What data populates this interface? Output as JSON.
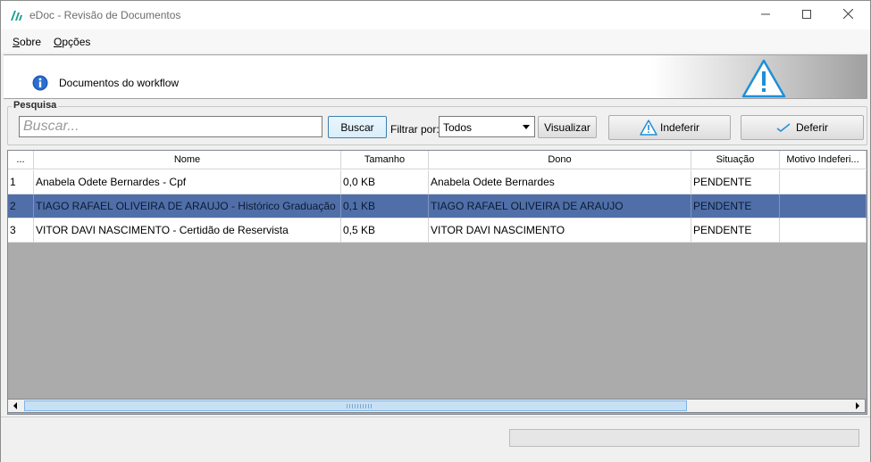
{
  "window": {
    "title": "eDoc - Revisão de Documentos",
    "controls": {
      "minimize": "minimize-icon",
      "maximize": "maximize-icon",
      "close": "close-icon"
    }
  },
  "menu": {
    "items": [
      {
        "label": "Sobre",
        "mnemonic": "S"
      },
      {
        "label": "Opções",
        "mnemonic": "O"
      }
    ]
  },
  "header": {
    "text": "Documentos do workflow",
    "icon": "info-icon",
    "banner_icon": "warning-triangle-icon"
  },
  "search": {
    "group_label": "Pesquisa",
    "placeholder": "Buscar...",
    "search_button": "Buscar",
    "filter_label": "Filtrar por:",
    "filter_value": "Todos",
    "view_button": "Visualizar",
    "reject_button": "Indeferir",
    "approve_button": "Deferir"
  },
  "table": {
    "columns": [
      "...",
      "Nome",
      "Tamanho",
      "Dono",
      "Situação",
      "Motivo Indeferi..."
    ],
    "rows": [
      {
        "id": "1",
        "nome": "Anabela Odete Bernardes - Cpf",
        "tamanho": "0,0 KB",
        "dono": "Anabela Odete Bernardes",
        "situacao": "PENDENTE",
        "motivo": ""
      },
      {
        "id": "2",
        "nome": "TIAGO RAFAEL OLIVEIRA DE ARAUJO - Histórico Graduação",
        "tamanho": "0,1 KB",
        "dono": "TIAGO RAFAEL OLIVEIRA DE ARAUJO",
        "situacao": "PENDENTE",
        "motivo": ""
      },
      {
        "id": "3",
        "nome": "VITOR DAVI NASCIMENTO - Certidão de Reservista",
        "tamanho": "0,5 KB",
        "dono": "VITOR DAVI NASCIMENTO",
        "situacao": "PENDENTE",
        "motivo": ""
      }
    ],
    "selected_row": 2
  },
  "colors": {
    "selection": "#506fa8",
    "grid_background": "#ababab",
    "brand": "#1fa090"
  }
}
